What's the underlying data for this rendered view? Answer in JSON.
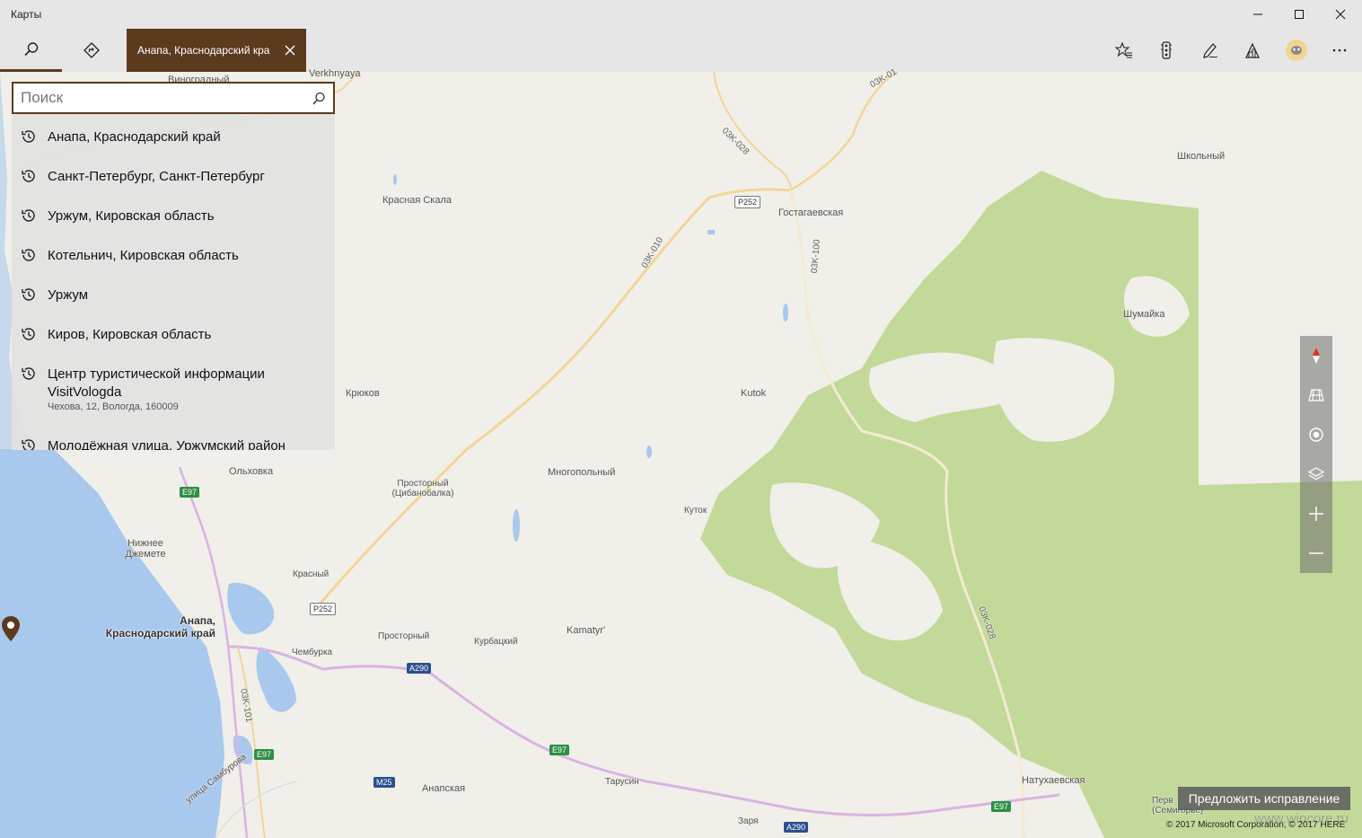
{
  "window": {
    "title": "Карты",
    "controls": [
      "minimize-icon",
      "maximize-icon",
      "close-icon"
    ]
  },
  "toolbar": {
    "search_tab_icon": "search-icon",
    "directions_tab_icon": "directions-icon",
    "active_tab": {
      "label": "Анапа, Краснодарский край",
      "close_icon": "close-icon"
    },
    "right_icons": [
      "favorites-icon",
      "traffic-icon",
      "ink-icon",
      "3d-cities-icon",
      "account-icon",
      "more-icon"
    ]
  },
  "search": {
    "placeholder": "Поиск",
    "value": "",
    "history": [
      {
        "label": "Анапа, Краснодарский край"
      },
      {
        "label": "Санкт-Петербург, Санкт-Петербург"
      },
      {
        "label": "Уржум, Кировская область"
      },
      {
        "label": "Котельнич, Кировская область"
      },
      {
        "label": "Уржум"
      },
      {
        "label": "Киров, Кировская область"
      },
      {
        "label": "Центр туристической информации VisitVologda",
        "sub": "Чехова, 12, Вологда, 160009"
      },
      {
        "label": "Молодёжная улица, Уржумский район"
      }
    ]
  },
  "map": {
    "places": [
      "Виноградный",
      "Verkhnyaya",
      "Красная Скала",
      "Гостагаевская",
      "Школьный",
      "Шумайка",
      "Крюков",
      "Kutok",
      "Ольховка",
      "Простоpный (Цибанобалка)",
      "Многопольный",
      "Куток",
      "Нижнее Джемете",
      "Красный",
      "Простоpный",
      "Курбацкий",
      "Kamatyr'",
      "Чембурка",
      "Анапская",
      "Тарусин",
      "Заря",
      "Натухаевская",
      "Перв (Семигорье)",
      "улица Самбурова"
    ],
    "roads": [
      "P252",
      "P252",
      "E97",
      "E97",
      "E97",
      "E97",
      "A290",
      "A290",
      "M25",
      "03K-010",
      "03K-028",
      "03K-100",
      "03K-101",
      "03K-028",
      "03K-01"
    ],
    "pin_label": [
      "Анапа,",
      "Краснодарский край"
    ],
    "colors": {
      "accent": "#5c3a1e",
      "forest": "#c3d99a",
      "water": "#a9c8ee",
      "land": "#f0efe9"
    }
  },
  "controls": {
    "compass": "compass-icon",
    "tilt": "tilt-icon",
    "location": "location-icon",
    "layers": "layers-icon",
    "zoom_in": "zoom-in-icon",
    "zoom_out": "zoom-out-icon"
  },
  "suggest_edit": "Предложить исправление",
  "copyright": "© 2017 Microsoft Corporation, © 2017 HERE",
  "watermark": "www.wincore.ru"
}
